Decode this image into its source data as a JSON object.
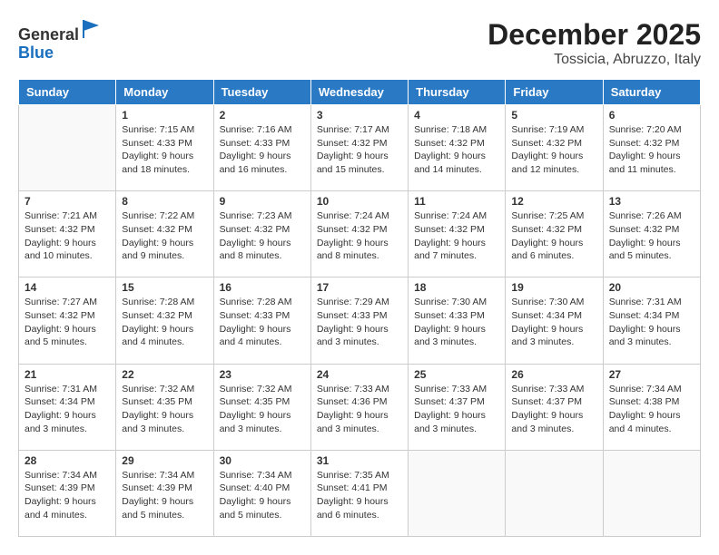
{
  "header": {
    "logo_general": "General",
    "logo_blue": "Blue",
    "month_title": "December 2025",
    "location": "Tossicia, Abruzzo, Italy"
  },
  "weekdays": [
    "Sunday",
    "Monday",
    "Tuesday",
    "Wednesday",
    "Thursday",
    "Friday",
    "Saturday"
  ],
  "weeks": [
    [
      {
        "day": "",
        "empty": true
      },
      {
        "day": "1",
        "sunrise": "7:15 AM",
        "sunset": "4:33 PM",
        "daylight": "9 hours and 18 minutes."
      },
      {
        "day": "2",
        "sunrise": "7:16 AM",
        "sunset": "4:33 PM",
        "daylight": "9 hours and 16 minutes."
      },
      {
        "day": "3",
        "sunrise": "7:17 AM",
        "sunset": "4:32 PM",
        "daylight": "9 hours and 15 minutes."
      },
      {
        "day": "4",
        "sunrise": "7:18 AM",
        "sunset": "4:32 PM",
        "daylight": "9 hours and 14 minutes."
      },
      {
        "day": "5",
        "sunrise": "7:19 AM",
        "sunset": "4:32 PM",
        "daylight": "9 hours and 12 minutes."
      },
      {
        "day": "6",
        "sunrise": "7:20 AM",
        "sunset": "4:32 PM",
        "daylight": "9 hours and 11 minutes."
      }
    ],
    [
      {
        "day": "7",
        "sunrise": "7:21 AM",
        "sunset": "4:32 PM",
        "daylight": "9 hours and 10 minutes."
      },
      {
        "day": "8",
        "sunrise": "7:22 AM",
        "sunset": "4:32 PM",
        "daylight": "9 hours and 9 minutes."
      },
      {
        "day": "9",
        "sunrise": "7:23 AM",
        "sunset": "4:32 PM",
        "daylight": "9 hours and 8 minutes."
      },
      {
        "day": "10",
        "sunrise": "7:24 AM",
        "sunset": "4:32 PM",
        "daylight": "9 hours and 8 minutes."
      },
      {
        "day": "11",
        "sunrise": "7:24 AM",
        "sunset": "4:32 PM",
        "daylight": "9 hours and 7 minutes."
      },
      {
        "day": "12",
        "sunrise": "7:25 AM",
        "sunset": "4:32 PM",
        "daylight": "9 hours and 6 minutes."
      },
      {
        "day": "13",
        "sunrise": "7:26 AM",
        "sunset": "4:32 PM",
        "daylight": "9 hours and 5 minutes."
      }
    ],
    [
      {
        "day": "14",
        "sunrise": "7:27 AM",
        "sunset": "4:32 PM",
        "daylight": "9 hours and 5 minutes."
      },
      {
        "day": "15",
        "sunrise": "7:28 AM",
        "sunset": "4:32 PM",
        "daylight": "9 hours and 4 minutes."
      },
      {
        "day": "16",
        "sunrise": "7:28 AM",
        "sunset": "4:33 PM",
        "daylight": "9 hours and 4 minutes."
      },
      {
        "day": "17",
        "sunrise": "7:29 AM",
        "sunset": "4:33 PM",
        "daylight": "9 hours and 3 minutes."
      },
      {
        "day": "18",
        "sunrise": "7:30 AM",
        "sunset": "4:33 PM",
        "daylight": "9 hours and 3 minutes."
      },
      {
        "day": "19",
        "sunrise": "7:30 AM",
        "sunset": "4:34 PM",
        "daylight": "9 hours and 3 minutes."
      },
      {
        "day": "20",
        "sunrise": "7:31 AM",
        "sunset": "4:34 PM",
        "daylight": "9 hours and 3 minutes."
      }
    ],
    [
      {
        "day": "21",
        "sunrise": "7:31 AM",
        "sunset": "4:34 PM",
        "daylight": "9 hours and 3 minutes."
      },
      {
        "day": "22",
        "sunrise": "7:32 AM",
        "sunset": "4:35 PM",
        "daylight": "9 hours and 3 minutes."
      },
      {
        "day": "23",
        "sunrise": "7:32 AM",
        "sunset": "4:35 PM",
        "daylight": "9 hours and 3 minutes."
      },
      {
        "day": "24",
        "sunrise": "7:33 AM",
        "sunset": "4:36 PM",
        "daylight": "9 hours and 3 minutes."
      },
      {
        "day": "25",
        "sunrise": "7:33 AM",
        "sunset": "4:37 PM",
        "daylight": "9 hours and 3 minutes."
      },
      {
        "day": "26",
        "sunrise": "7:33 AM",
        "sunset": "4:37 PM",
        "daylight": "9 hours and 3 minutes."
      },
      {
        "day": "27",
        "sunrise": "7:34 AM",
        "sunset": "4:38 PM",
        "daylight": "9 hours and 4 minutes."
      }
    ],
    [
      {
        "day": "28",
        "sunrise": "7:34 AM",
        "sunset": "4:39 PM",
        "daylight": "9 hours and 4 minutes."
      },
      {
        "day": "29",
        "sunrise": "7:34 AM",
        "sunset": "4:39 PM",
        "daylight": "9 hours and 5 minutes."
      },
      {
        "day": "30",
        "sunrise": "7:34 AM",
        "sunset": "4:40 PM",
        "daylight": "9 hours and 5 minutes."
      },
      {
        "day": "31",
        "sunrise": "7:35 AM",
        "sunset": "4:41 PM",
        "daylight": "9 hours and 6 minutes."
      },
      {
        "day": "",
        "empty": true
      },
      {
        "day": "",
        "empty": true
      },
      {
        "day": "",
        "empty": true
      }
    ]
  ],
  "labels": {
    "sunrise_prefix": "Sunrise: ",
    "sunset_prefix": "Sunset: ",
    "daylight_prefix": "Daylight: "
  }
}
